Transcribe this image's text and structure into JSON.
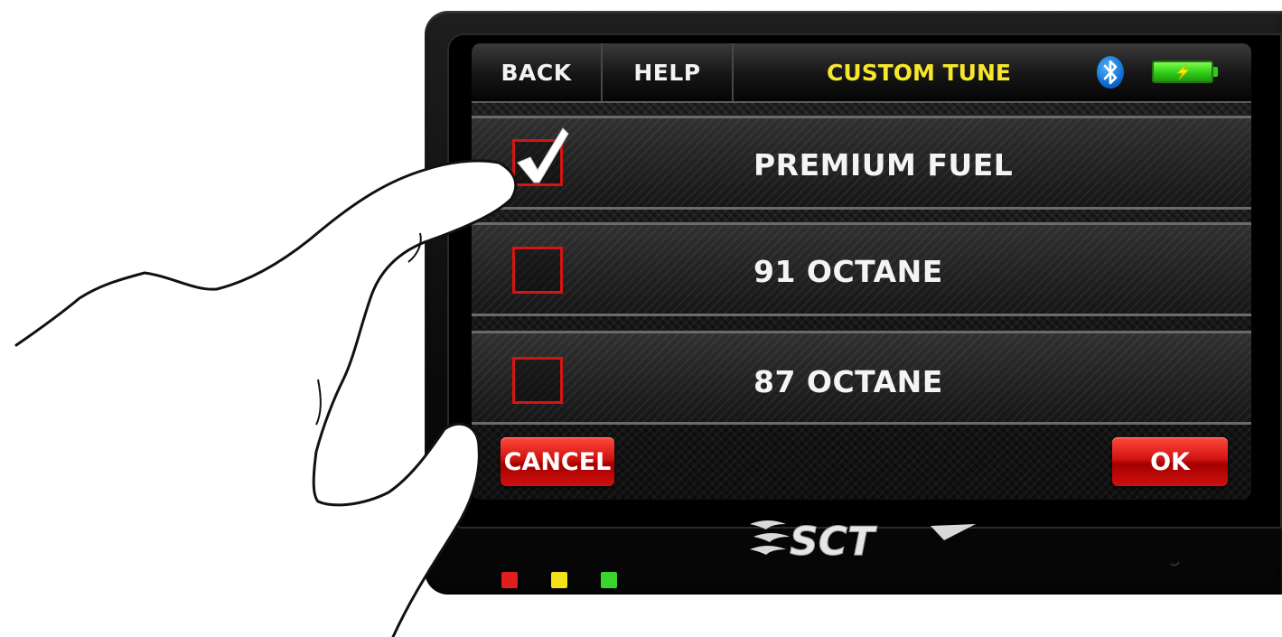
{
  "header": {
    "back_label": "BACK",
    "help_label": "HELP",
    "title": "CUSTOM TUNE",
    "bluetooth_icon": "bluetooth-icon",
    "battery_icon": "battery-charging-icon"
  },
  "options": [
    {
      "label": "PREMIUM FUEL",
      "checked": true
    },
    {
      "label": "91 OCTANE",
      "checked": false
    },
    {
      "label": "87 OCTANE",
      "checked": false
    }
  ],
  "footer": {
    "cancel_label": "CANCEL",
    "ok_label": "OK"
  },
  "device": {
    "logo_text": "SCT",
    "indicator_colors": [
      "#e01e1e",
      "#f2e018",
      "#39d52a"
    ]
  },
  "colors": {
    "title": "#f6e62c",
    "checkbox": "#d51414",
    "button": "#d11212",
    "accent_blue": "#1a86ea",
    "battery_green": "#2fcc17"
  }
}
